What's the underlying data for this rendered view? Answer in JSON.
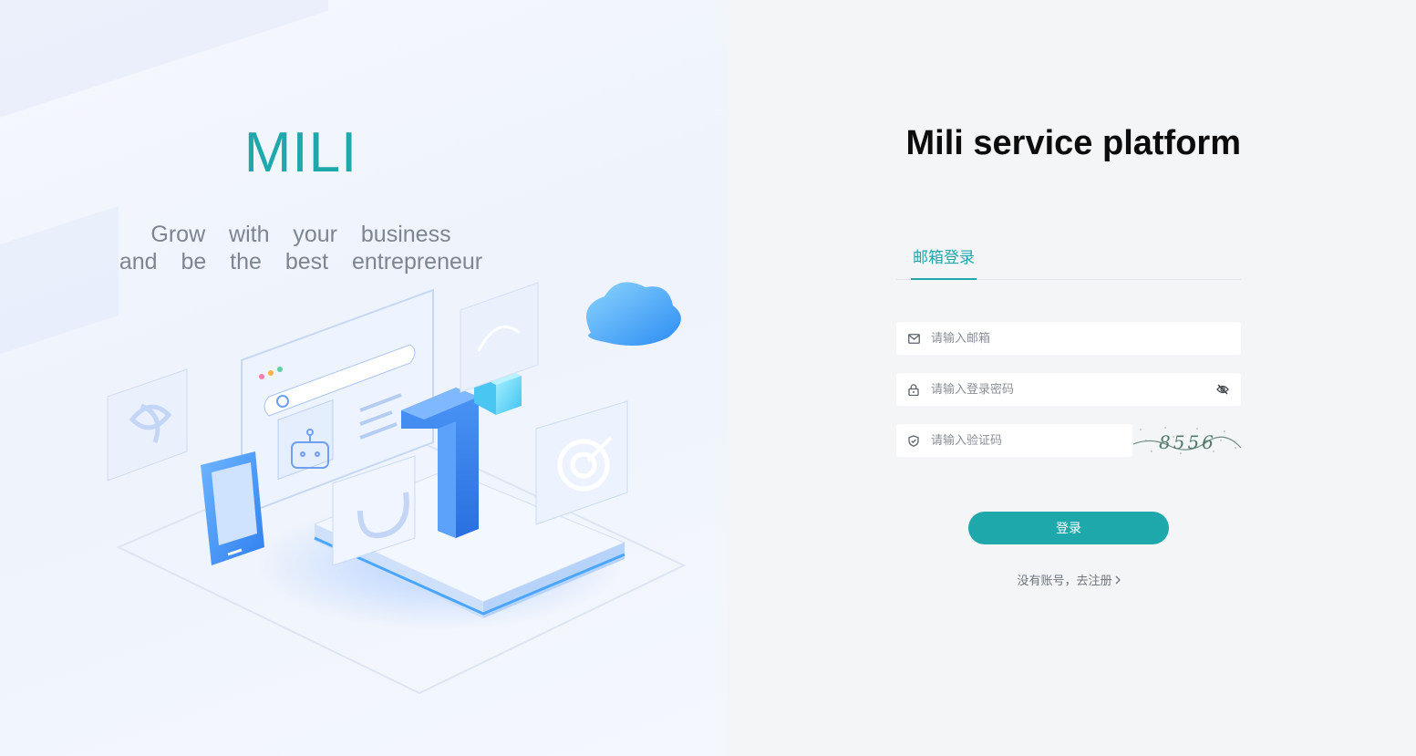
{
  "brand": {
    "name": "MILI",
    "tagline_line1": "Grow  with  your  business",
    "tagline_line2": "and  be  the  best  entrepreneur"
  },
  "colors": {
    "accent": "#1ea8ac",
    "title": "#0c0c0c",
    "panel_bg": "#f4f5f7"
  },
  "login": {
    "title": "Mili service platform",
    "tabs": [
      {
        "label": "邮箱登录",
        "active": true
      }
    ],
    "email": {
      "placeholder": "请输入邮箱",
      "value": "",
      "icon": "mail-icon"
    },
    "password": {
      "placeholder": "请输入登录密码",
      "value": "",
      "icon": "lock-icon",
      "toggle_icon": "eye-off-icon"
    },
    "captcha": {
      "placeholder": "请输入验证码",
      "value": "",
      "icon": "shield-icon",
      "image_text": "8556"
    },
    "submit_label": "登录",
    "register_text": "没有账号，去注册"
  }
}
